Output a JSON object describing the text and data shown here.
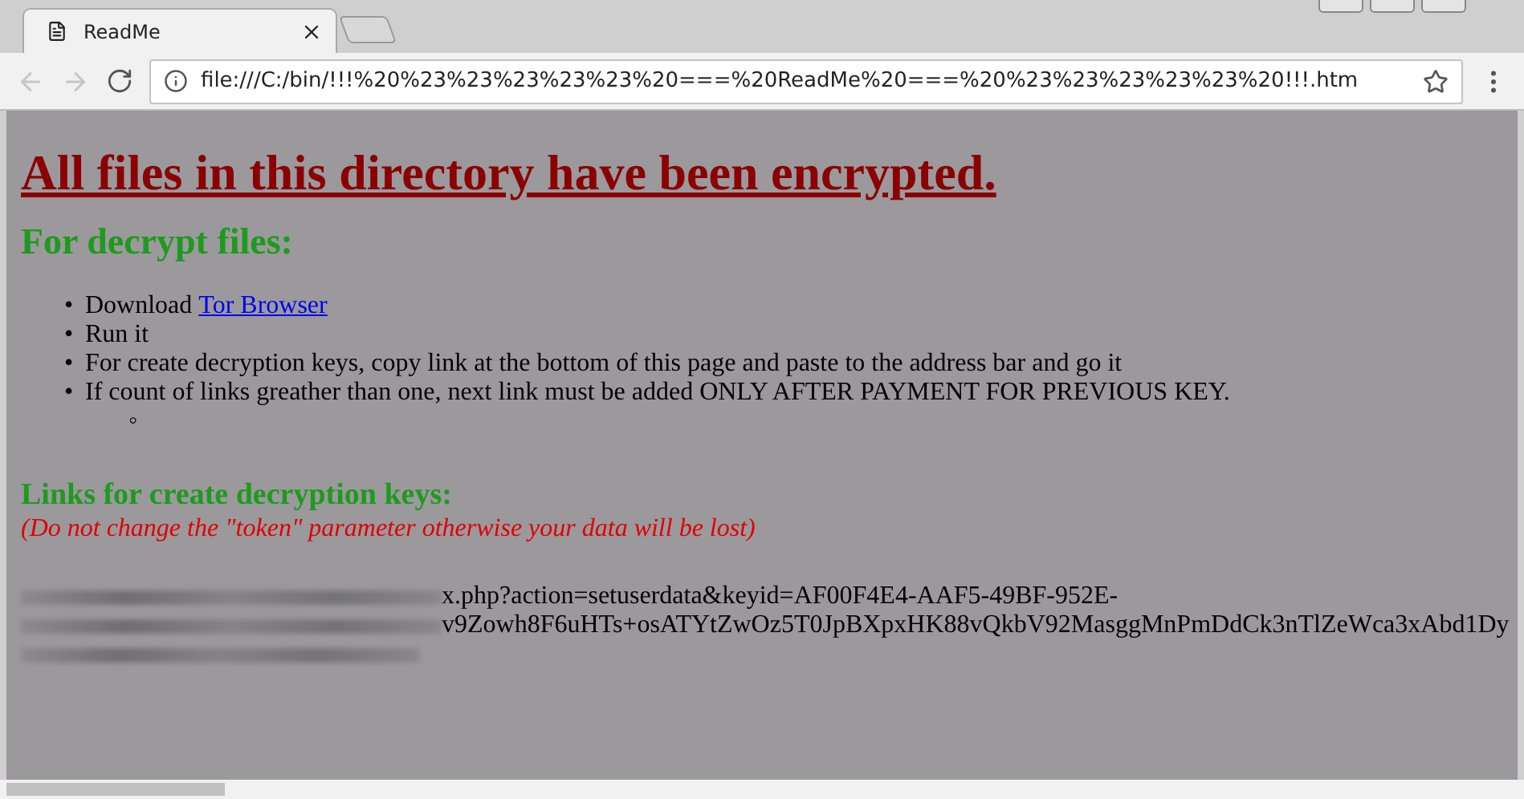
{
  "tab": {
    "title": "ReadMe",
    "selected": true
  },
  "address_bar": {
    "url": "file:///C:/bin/!!!%20%23%23%23%23%23%20===%20ReadMe%20===%20%23%23%23%23%23%20!!!.htm"
  },
  "page": {
    "heading": "All files in this directory have been encrypted.",
    "subheading": "For decrypt files:",
    "steps": [
      {
        "marker": "•",
        "text": "Download ",
        "link": "Tor Browser"
      },
      {
        "marker": "•",
        "text": "Run it"
      },
      {
        "marker": "•",
        "text": "For create decryption keys, copy link at the bottom of this page and paste to the address bar and go it"
      },
      {
        "marker": "•",
        "text": "If count of links greather than one, next link must be added ONLY AFTER PAYMENT FOR PREVIOUS KEY."
      }
    ],
    "sub_marker": "◦",
    "links_heading": "Links for create decryption keys:",
    "warning": "(Do not change the \"token\" parameter otherwise your data will be lost)",
    "key_link_lines": [
      "x.php?action=setuserdata&keyid=AF00F4E4-AAF5-49BF-952E-",
      "v9Zowh8F6uHTs+osATYtZwOz5T0JpBXpxHK88vQkbV92MasggMnPmDdCk3nTlZeWca3xAbd1Dy"
    ]
  }
}
